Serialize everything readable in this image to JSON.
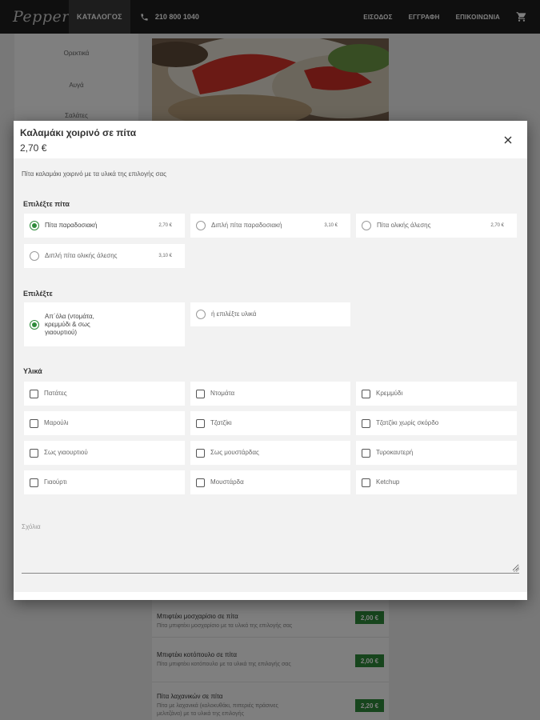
{
  "header": {
    "logo": "Peppers",
    "catalog": "ΚΑΤΑΛΟΓΟΣ",
    "phone": "210 800 1040",
    "login": "ΕΙΣΟΔΟΣ",
    "register": "ΕΓΓΡΑΦΗ",
    "contact": "ΕΠΙΚΟΙΝΩΝΙΑ",
    "cart_icon": "cart-icon",
    "phone_icon": "phone-icon"
  },
  "background": {
    "categories": [
      "Ορεκτικά",
      "Αυγά",
      "Σαλάτες"
    ],
    "items": [
      {
        "name": "Μπιφτέκι μοσχαρίσιο σε πίτα",
        "desc": "Πίτα μπιφτέκι μοσχαρίσιο με τα υλικά της επιλογής σας",
        "price": "2,00 €"
      },
      {
        "name": "Μπιφτέκι κοτόπουλο σε πίτα",
        "desc": "Πίτα μπιφτέκι κοτόπουλο με τα υλικά της επιλογής σας",
        "price": "2,00 €"
      },
      {
        "name": "Πίτα λαχανικών σε πίτα",
        "desc": "Πίτα με λαχανικά (κολοκυθάκι, πιπεριές πράσινες",
        "desc2": "μελιτζάνα) με τα υλικά της επιλογής",
        "price": "2,20 €"
      }
    ]
  },
  "modal": {
    "title": "Καλαμάκι χοιρινό σε πίτα",
    "price": "2,70 €",
    "description": "Πίτα καλαμάκι χοιρινό με τα υλικά της επιλογής σας",
    "close_icon": "close-icon",
    "pita": {
      "title": "Επιλέξτε πίτα",
      "options": [
        {
          "label": "Πίτα παραδοσιακή",
          "price": "2,70 €",
          "selected": true
        },
        {
          "label": "Διπλή πίτα παραδοσιακή",
          "price": "3,10 €",
          "selected": false
        },
        {
          "label": "Πίτα ολικής άλεσης",
          "price": "2,70 €",
          "selected": false
        },
        {
          "label": "Διπλή πίτα ολικής άλεσης",
          "price": "3,10 €",
          "selected": false
        }
      ]
    },
    "choose": {
      "title": "Επιλέξτε",
      "option1": "Απ΄όλα (ντομάτα,",
      "option1_line2": "κρεμμύδι & σως",
      "option1_line3": "γιαουρτιού)",
      "option2": "ή επιλέξτε υλικά"
    },
    "ingredients": {
      "title": "Υλικά",
      "items": [
        "Πατάτες",
        "Ντομάτα",
        "Κρεμμύδι",
        "Μαρούλι",
        "Τζατζίκι",
        "Τζατζίκι χωρίς σκόρδο",
        "Σως γιαουρτιού",
        "Σως μουστάρδας",
        "Τυροκαυτερή",
        "Γιαούρτι",
        "Μουστάρδα",
        "Ketchup"
      ]
    },
    "notes": {
      "label": "Σχόλια",
      "value": ""
    }
  }
}
